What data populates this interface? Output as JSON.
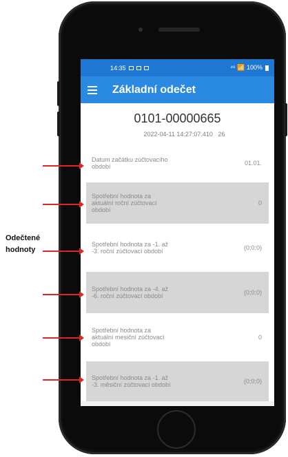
{
  "annotation": {
    "line1": "Odečtené",
    "line2": "hodnoty"
  },
  "status_bar": {
    "time": "14:35",
    "right": "⁴⁶ 📶 100%"
  },
  "app_bar": {
    "title": "Základní odečet"
  },
  "meter": {
    "id": "0101-00000665",
    "timestamp": "2022-04-11 14:27:07.410",
    "code": "26"
  },
  "rows": [
    {
      "label": "Datum začátku zúčtovacího období",
      "value": "01.01."
    },
    {
      "label": "Spotřební hodnota za aktuální roční zúčtovací období",
      "value": "0"
    },
    {
      "label": "Spotřební hodnota za -1. až -3. roční zúčtovací období",
      "value": "(0;0;0)"
    },
    {
      "label": "Spotřební hodnota za -4. až -6. roční zúčtovací období",
      "value": "(0;0;0)"
    },
    {
      "label": "Spotřební hodnota za aktuální mesiční zúčtovací období",
      "value": "0"
    },
    {
      "label": "Spotřební hodnota za -1. až -3. měsiční zúčtovací období",
      "value": "(0;0;0)"
    }
  ]
}
